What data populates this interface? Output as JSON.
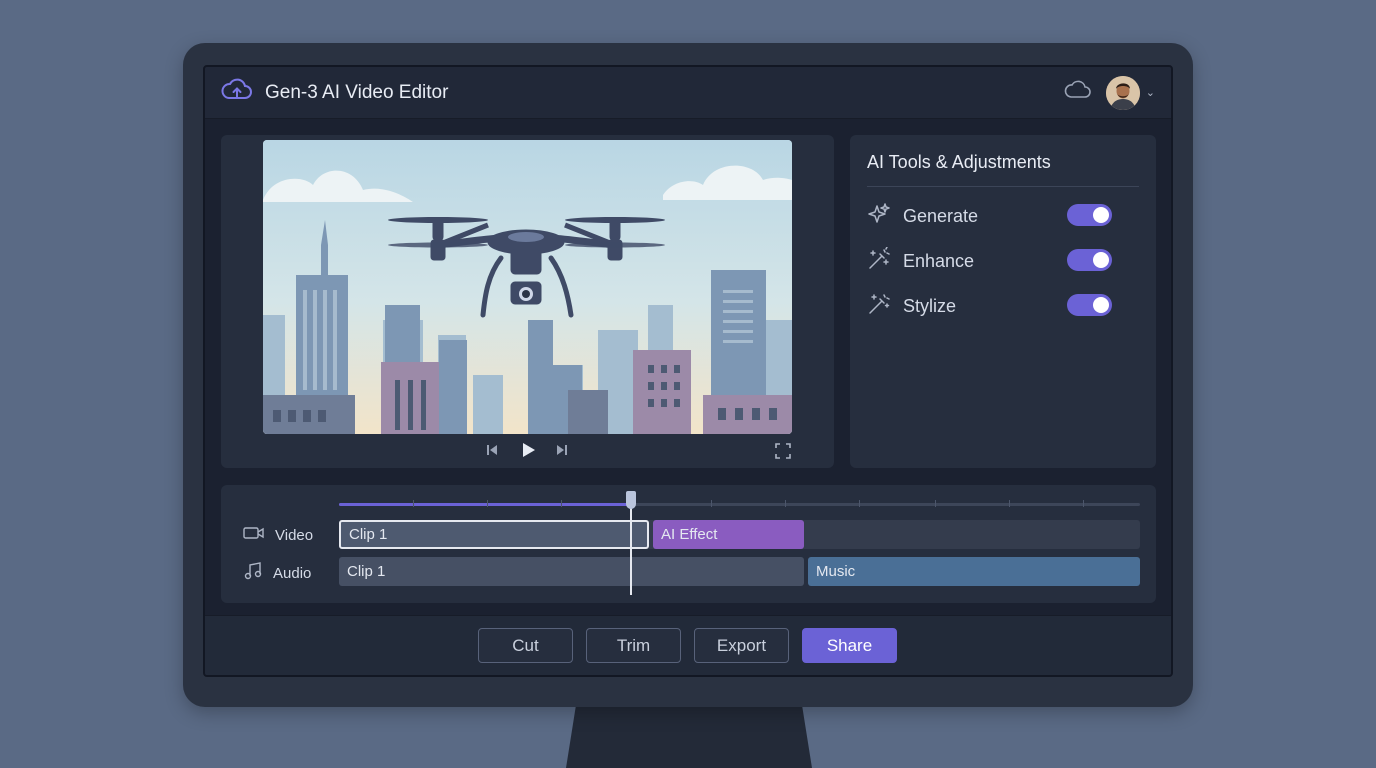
{
  "app": {
    "title": "Gen-3 AI Video Editor",
    "logo_icon": "cloud-upload-icon",
    "cloud_icon": "cloud-icon",
    "avatar_icon": "user-avatar",
    "menu_icon": "chevron-down-icon"
  },
  "preview": {
    "controls": [
      "skip-back-icon",
      "play-icon",
      "skip-forward-icon",
      "fullscreen-icon"
    ]
  },
  "tools": {
    "title": "AI Tools & Adjustments",
    "items": [
      {
        "label": "Generate",
        "icon": "sparkles-icon",
        "enabled": true
      },
      {
        "label": "Enhance",
        "icon": "magic-wand-icon",
        "enabled": true
      },
      {
        "label": "Stylize",
        "icon": "magic-wand-icon",
        "enabled": true
      }
    ]
  },
  "timeline": {
    "playhead_fraction": 0.365,
    "tracks": [
      {
        "label": "Video",
        "icon": "video-camera-icon",
        "clips": [
          {
            "label": "Clip 1",
            "color": "#4e5a70",
            "selected": true
          },
          {
            "label": "AI Effect",
            "color": "#8a5cc0"
          }
        ]
      },
      {
        "label": "Audio",
        "icon": "music-note-icon",
        "clips": [
          {
            "label": "Clip 1",
            "color": "#465064"
          },
          {
            "label": "Music",
            "color": "#4a6f96"
          }
        ]
      }
    ]
  },
  "actions": {
    "cut": "Cut",
    "trim": "Trim",
    "export": "Export",
    "share": "Share"
  },
  "colors": {
    "accent": "#6b62d6",
    "ai_effect": "#8a5cc0",
    "music": "#4a6f96"
  }
}
